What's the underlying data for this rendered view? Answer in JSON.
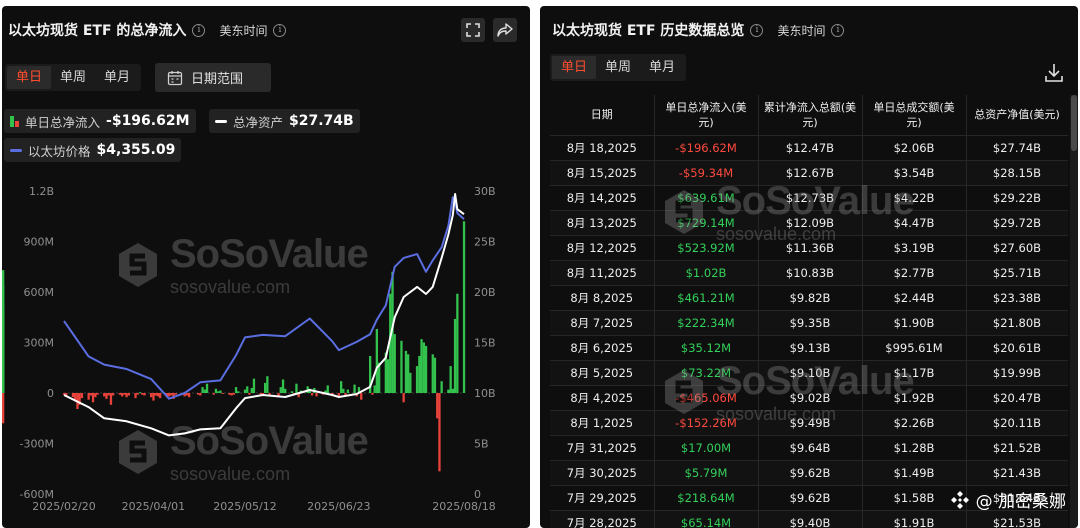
{
  "left_panel": {
    "title": "以太坊现货 ETF 的总净流入",
    "timezone": "美东时间",
    "tabs": [
      "单日",
      "单周",
      "单月"
    ],
    "active_tab": "单日",
    "date_range_label": "日期范围",
    "legend": {
      "net_inflow_label": "单日总净流入",
      "net_inflow_value": "-$196.62M",
      "net_assets_label": "总净资产",
      "net_assets_value": "$27.74B",
      "eth_price_label": "以太坊价格",
      "eth_price_value": "$4,355.09"
    },
    "watermark": {
      "brand": "SoSoValue",
      "domain": "sosovalue.com"
    }
  },
  "chart_data": {
    "type": "bar",
    "title": "以太坊现货 ETF 的总净流入",
    "x_ticks": [
      "2025/02/20",
      "2025/04/01",
      "2025/05/12",
      "2025/06/23",
      "2025/08/18"
    ],
    "y_left_ticks": [
      "1.2B",
      "900M",
      "600M",
      "300M",
      "0",
      "-300M",
      "-600M"
    ],
    "y_left_range_millions": [
      -600,
      1200
    ],
    "y_right_ticks": [
      "30B",
      "25B",
      "20B",
      "15B",
      "10B",
      "5B",
      "0"
    ],
    "y_right_range_billions": [
      0,
      30
    ],
    "grid": false,
    "colors": {
      "positive_bar": "#32c24d",
      "negative_bar": "#e8433a",
      "net_assets_line": "#ffffff",
      "eth_price_line": "#5b6ee1"
    },
    "series": [
      {
        "name": "单日总净流入",
        "type": "bar",
        "unit": "M USD",
        "dates": [
          "2025-02-20",
          "2025-02-21",
          "2025-02-24",
          "2025-02-25",
          "2025-02-26",
          "2025-02-27",
          "2025-02-28",
          "2025-03-03",
          "2025-03-04",
          "2025-03-05",
          "2025-03-06",
          "2025-03-07",
          "2025-03-10",
          "2025-03-11",
          "2025-03-12",
          "2025-03-13",
          "2025-03-14",
          "2025-03-17",
          "2025-03-18",
          "2025-03-19",
          "2025-03-20",
          "2025-03-21",
          "2025-03-24",
          "2025-03-25",
          "2025-03-26",
          "2025-03-27",
          "2025-03-28",
          "2025-03-31",
          "2025-04-01",
          "2025-04-02",
          "2025-04-03",
          "2025-04-04",
          "2025-04-07",
          "2025-04-08",
          "2025-04-09",
          "2025-04-10",
          "2025-04-11",
          "2025-04-14",
          "2025-04-15",
          "2025-04-16",
          "2025-04-17",
          "2025-04-21",
          "2025-04-22",
          "2025-04-23",
          "2025-04-24",
          "2025-04-25",
          "2025-04-28",
          "2025-04-29",
          "2025-04-30",
          "2025-05-01",
          "2025-05-02",
          "2025-05-05",
          "2025-05-06",
          "2025-05-07",
          "2025-05-08",
          "2025-05-09",
          "2025-05-12",
          "2025-05-13",
          "2025-05-14",
          "2025-05-15",
          "2025-05-16",
          "2025-05-19",
          "2025-05-20",
          "2025-05-21",
          "2025-05-22",
          "2025-05-23",
          "2025-05-27",
          "2025-05-28",
          "2025-05-29",
          "2025-05-30",
          "2025-06-02",
          "2025-06-03",
          "2025-06-04",
          "2025-06-05",
          "2025-06-06",
          "2025-06-09",
          "2025-06-10",
          "2025-06-11",
          "2025-06-12",
          "2025-06-13",
          "2025-06-16",
          "2025-06-17",
          "2025-06-18",
          "2025-06-20",
          "2025-06-23",
          "2025-06-24",
          "2025-06-25",
          "2025-06-26",
          "2025-06-27",
          "2025-06-30",
          "2025-07-01",
          "2025-07-02",
          "2025-07-03",
          "2025-07-07",
          "2025-07-08",
          "2025-07-09",
          "2025-07-10",
          "2025-07-11",
          "2025-07-14",
          "2025-07-15",
          "2025-07-16",
          "2025-07-17",
          "2025-07-18",
          "2025-07-21",
          "2025-07-22",
          "2025-07-23",
          "2025-07-24",
          "2025-07-25",
          "2025-07-28",
          "2025-07-29",
          "2025-07-30",
          "2025-07-31",
          "2025-08-01",
          "2025-08-04",
          "2025-08-05",
          "2025-08-06",
          "2025-08-07",
          "2025-08-08",
          "2025-08-11",
          "2025-08-12",
          "2025-08-13",
          "2025-08-14",
          "2025-08-15",
          "2025-08-18"
        ],
        "values": [
          -10,
          -15,
          -25,
          -50,
          -95,
          -70,
          -30,
          -40,
          -15,
          -55,
          -25,
          -10,
          -20,
          -35,
          -15,
          -70,
          -15,
          -10,
          -20,
          -10,
          -25,
          -15,
          -30,
          -10,
          5,
          -10,
          -15,
          -25,
          -45,
          -15,
          -20,
          -30,
          -25,
          -20,
          -15,
          -35,
          -10,
          -10,
          -20,
          -15,
          -25,
          -10,
          -15,
          35,
          20,
          55,
          -10,
          25,
          10,
          15,
          -5,
          -10,
          -15,
          -10,
          35,
          10,
          20,
          40,
          -10,
          30,
          85,
          -15,
          -15,
          60,
          100,
          -10,
          -20,
          35,
          80,
          25,
          10,
          -10,
          55,
          -25,
          15,
          40,
          25,
          -15,
          30,
          -20,
          -10,
          15,
          45,
          -10,
          -25,
          70,
          25,
          -15,
          20,
          50,
          -20,
          35,
          -40,
          220,
          -10,
          45,
          380,
          180,
          240,
          200,
          590,
          720,
          350,
          310,
          -55,
          250,
          230,
          120,
          160,
          220,
          320,
          300,
          280,
          230,
          210,
          -150,
          -465,
          70,
          20,
          160,
          25,
          440,
          590,
          1020,
          730,
          640,
          520,
          -180
        ],
        "color_positive": "#32c24d",
        "color_negative": "#e8433a"
      },
      {
        "name": "总净资产",
        "type": "line",
        "axis": "right",
        "unit": "B USD",
        "dates": [
          "2025-02-20",
          "2025-03-03",
          "2025-03-10",
          "2025-03-20",
          "2025-03-31",
          "2025-04-08",
          "2025-04-15",
          "2025-04-22",
          "2025-05-01",
          "2025-05-08",
          "2025-05-12",
          "2025-05-20",
          "2025-05-30",
          "2025-06-10",
          "2025-06-20",
          "2025-06-23",
          "2025-07-01",
          "2025-07-07",
          "2025-07-10",
          "2025-07-14",
          "2025-07-18",
          "2025-07-22",
          "2025-07-28",
          "2025-08-01",
          "2025-08-04",
          "2025-08-08",
          "2025-08-11",
          "2025-08-13",
          "2025-08-14",
          "2025-08-15",
          "2025-08-18"
        ],
        "values": [
          9.8,
          8.6,
          7.5,
          7.2,
          6.5,
          5.8,
          6.0,
          6.4,
          6.5,
          8.5,
          9.5,
          9.8,
          9.6,
          10.3,
          9.8,
          9.6,
          9.9,
          10.6,
          12.5,
          13.5,
          17.5,
          19.5,
          20.5,
          19.8,
          20.5,
          23.4,
          25.7,
          27.6,
          29.7,
          28.2,
          27.7
        ]
      },
      {
        "name": "以太坊价格",
        "type": "line",
        "unit": "USD",
        "dates": [
          "2025-02-20",
          "2025-03-03",
          "2025-03-10",
          "2025-03-20",
          "2025-03-31",
          "2025-04-08",
          "2025-04-15",
          "2025-04-22",
          "2025-05-01",
          "2025-05-08",
          "2025-05-12",
          "2025-05-20",
          "2025-05-30",
          "2025-06-10",
          "2025-06-20",
          "2025-06-23",
          "2025-07-01",
          "2025-07-07",
          "2025-07-10",
          "2025-07-14",
          "2025-07-18",
          "2025-07-22",
          "2025-07-28",
          "2025-08-01",
          "2025-08-04",
          "2025-08-08",
          "2025-08-11",
          "2025-08-13",
          "2025-08-14",
          "2025-08-15",
          "2025-08-18"
        ],
        "values": [
          2740,
          2180,
          2050,
          1980,
          1820,
          1510,
          1600,
          1770,
          1800,
          2200,
          2480,
          2520,
          2500,
          2780,
          2420,
          2280,
          2410,
          2530,
          2760,
          2990,
          3600,
          3740,
          3800,
          3520,
          3700,
          3910,
          4250,
          4700,
          4640,
          4450,
          4355
        ]
      }
    ]
  },
  "right_panel": {
    "title": "以太坊现货 ETF 历史数据总览",
    "timezone": "美东时间",
    "tabs": [
      "单日",
      "单周",
      "单月"
    ],
    "active_tab": "单日",
    "table": {
      "columns": [
        "日期",
        "单日总净流入(美元)",
        "累计净流入总额(美元)",
        "单日总成交额(美元)",
        "总资产净值(美元)"
      ],
      "rows": [
        {
          "date": "8月 18,2025",
          "net_inflow": "-$196.62M",
          "dir": "neg",
          "cumulative": "$12.47B",
          "volume": "$2.06B",
          "nav": "$27.74B"
        },
        {
          "date": "8月 15,2025",
          "net_inflow": "-$59.34M",
          "dir": "neg",
          "cumulative": "$12.67B",
          "volume": "$3.54B",
          "nav": "$28.15B"
        },
        {
          "date": "8月 14,2025",
          "net_inflow": "$639.61M",
          "dir": "pos",
          "cumulative": "$12.73B",
          "volume": "$4.22B",
          "nav": "$29.22B"
        },
        {
          "date": "8月 13,2025",
          "net_inflow": "$729.14M",
          "dir": "pos",
          "cumulative": "$12.09B",
          "volume": "$4.47B",
          "nav": "$29.72B"
        },
        {
          "date": "8月 12,2025",
          "net_inflow": "$523.92M",
          "dir": "pos",
          "cumulative": "$11.36B",
          "volume": "$3.19B",
          "nav": "$27.60B"
        },
        {
          "date": "8月 11,2025",
          "net_inflow": "$1.02B",
          "dir": "pos",
          "cumulative": "$10.83B",
          "volume": "$2.77B",
          "nav": "$25.71B"
        },
        {
          "date": "8月 8,2025",
          "net_inflow": "$461.21M",
          "dir": "pos",
          "cumulative": "$9.82B",
          "volume": "$2.44B",
          "nav": "$23.38B"
        },
        {
          "date": "8月 7,2025",
          "net_inflow": "$222.34M",
          "dir": "pos",
          "cumulative": "$9.35B",
          "volume": "$1.90B",
          "nav": "$21.80B"
        },
        {
          "date": "8月 6,2025",
          "net_inflow": "$35.12M",
          "dir": "pos",
          "cumulative": "$9.13B",
          "volume": "$995.61M",
          "nav": "$20.61B"
        },
        {
          "date": "8月 5,2025",
          "net_inflow": "$73.22M",
          "dir": "pos",
          "cumulative": "$9.10B",
          "volume": "$1.17B",
          "nav": "$19.99B"
        },
        {
          "date": "8月 4,2025",
          "net_inflow": "-$465.06M",
          "dir": "neg",
          "cumulative": "$9.02B",
          "volume": "$1.92B",
          "nav": "$20.47B"
        },
        {
          "date": "8月 1,2025",
          "net_inflow": "-$152.26M",
          "dir": "neg",
          "cumulative": "$9.49B",
          "volume": "$2.26B",
          "nav": "$20.11B"
        },
        {
          "date": "7月 31,2025",
          "net_inflow": "$17.00M",
          "dir": "pos",
          "cumulative": "$9.64B",
          "volume": "$1.28B",
          "nav": "$21.52B"
        },
        {
          "date": "7月 30,2025",
          "net_inflow": "$5.79M",
          "dir": "pos",
          "cumulative": "$9.62B",
          "volume": "$1.49B",
          "nav": "$21.43B"
        },
        {
          "date": "7月 29,2025",
          "net_inflow": "$218.64M",
          "dir": "pos",
          "cumulative": "$9.62B",
          "volume": "$1.58B",
          "nav": "$21.64B"
        },
        {
          "date": "7月 28,2025",
          "net_inflow": "$65.14M",
          "dir": "pos",
          "cumulative": "$9.40B",
          "volume": "$1.91B",
          "nav": "$21.53B"
        }
      ]
    },
    "watermark": {
      "brand": "SoSoValue",
      "domain": "sosovalue.com"
    }
  },
  "credit": {
    "handle": "@ 加密桑娜"
  }
}
